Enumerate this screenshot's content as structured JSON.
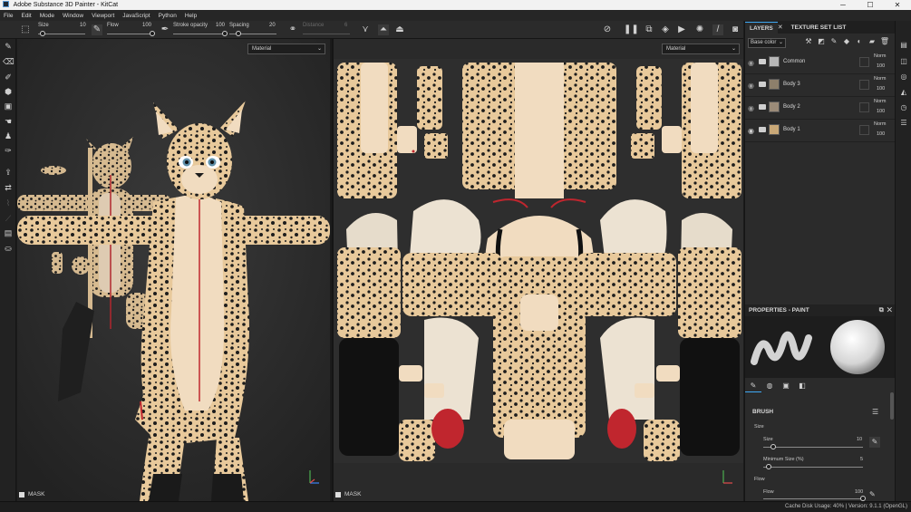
{
  "window": {
    "title": "Adobe Substance 3D Painter - KitCat",
    "controls": [
      "─",
      "☐",
      "✕"
    ]
  },
  "menu": [
    "File",
    "Edit",
    "Mode",
    "Window",
    "Viewport",
    "JavaScript",
    "Python",
    "Help"
  ],
  "toolbar": {
    "size_label": "Size",
    "size_value": "10",
    "size_level": 0.1,
    "flow_label": "Flow",
    "flow_value": "100",
    "flow_level": 1.0,
    "stroke_opacity_label": "Stroke opacity",
    "stroke_opacity_value": "100",
    "stroke_opacity_level": 1.0,
    "spacing_label": "Spacing",
    "spacing_value": "20",
    "spacing_level": 0.2,
    "distance_label": "Distance",
    "distance_value": "6"
  },
  "viewport_left": {
    "material_select": "Material",
    "mask_label": "MASK"
  },
  "viewport_right": {
    "material_select": "Material",
    "mask_label": "MASK"
  },
  "layers_panel": {
    "tabs": [
      "LAYERS",
      "TEXTURE SET LIST"
    ],
    "channel": "Base color",
    "layers": [
      {
        "name": "Common",
        "blend": "Norm",
        "opacity": "100"
      },
      {
        "name": "Body 3",
        "blend": "Norm",
        "opacity": "100"
      },
      {
        "name": "Body 2",
        "blend": "Norm",
        "opacity": "100"
      },
      {
        "name": "Body 1",
        "blend": "Norm",
        "opacity": "100"
      }
    ]
  },
  "properties": {
    "title": "PROPERTIES - PAINT",
    "brush_section": "BRUSH",
    "size_group": "Size",
    "size_label": "Size",
    "size_value": "10",
    "size_level": 0.1,
    "min_size_label": "Minimum Size (%)",
    "min_size_value": "5",
    "min_size_level": 0.05,
    "flow_group": "Flow",
    "flow_label": "Flow",
    "flow_value": "100",
    "flow_level": 1.0
  },
  "status": {
    "text": "Cache Disk Usage:   40%  |  Version: 9.1.1 (OpenGL)"
  },
  "colors": {
    "accent": "#3fa9f5",
    "fur": "#e8c99b",
    "belly": "#f1dcc0",
    "spots": "#1c1c1c",
    "red": "#c0262e"
  }
}
